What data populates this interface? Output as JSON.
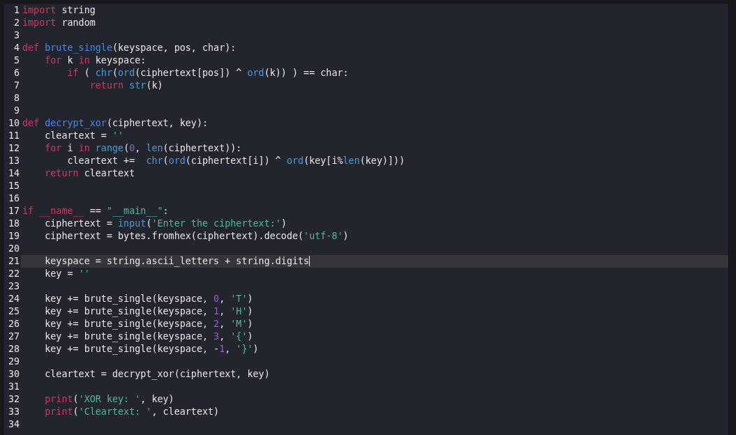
{
  "editor": {
    "lines": [
      {
        "number": "1",
        "current": false,
        "tokens": [
          {
            "kind": "keyword",
            "text": "import"
          },
          {
            "kind": "plain",
            "text": " string"
          }
        ]
      },
      {
        "number": "2",
        "current": false,
        "tokens": [
          {
            "kind": "keyword",
            "text": "import"
          },
          {
            "kind": "plain",
            "text": " random"
          }
        ]
      },
      {
        "number": "3",
        "current": false
      },
      {
        "number": "4",
        "current": false,
        "tokens": [
          {
            "kind": "keyword",
            "text": "def "
          },
          {
            "kind": "function",
            "text": "brute_single"
          },
          {
            "kind": "plain",
            "text": "(keyspace, pos, char):"
          }
        ]
      },
      {
        "number": "5",
        "current": false,
        "tokens": [
          {
            "kind": "keyword",
            "text": "    for"
          },
          {
            "kind": "plain",
            "text": " k "
          },
          {
            "kind": "keyword",
            "text": "in"
          },
          {
            "kind": "plain",
            "text": " keyspace:"
          }
        ]
      },
      {
        "number": "6",
        "current": false,
        "tokens": [
          {
            "kind": "keyword",
            "text": "        if"
          },
          {
            "kind": "plain",
            "text": " ( "
          },
          {
            "kind": "builtin",
            "text": "chr"
          },
          {
            "kind": "plain",
            "text": "("
          },
          {
            "kind": "builtin",
            "text": "ord"
          },
          {
            "kind": "plain",
            "text": "(ciphertext[pos]) ^ "
          },
          {
            "kind": "builtin",
            "text": "ord"
          },
          {
            "kind": "plain",
            "text": "(k)) ) == char:"
          }
        ]
      },
      {
        "number": "7",
        "current": false,
        "tokens": [
          {
            "kind": "keyword",
            "text": "            return "
          },
          {
            "kind": "builtin",
            "text": "str"
          },
          {
            "kind": "plain",
            "text": "(k)"
          }
        ]
      },
      {
        "number": "8",
        "current": false
      },
      {
        "number": "9",
        "current": false
      },
      {
        "number": "10",
        "current": false,
        "tokens": [
          {
            "kind": "keyword",
            "text": "def "
          },
          {
            "kind": "function",
            "text": "decrypt_xor"
          },
          {
            "kind": "plain",
            "text": "(ciphertext, key):"
          }
        ]
      },
      {
        "number": "11",
        "current": false,
        "tokens": [
          {
            "kind": "plain",
            "text": "    cleartext = "
          },
          {
            "kind": "string",
            "text": "''"
          }
        ]
      },
      {
        "number": "12",
        "current": false,
        "tokens": [
          {
            "kind": "keyword",
            "text": "    for"
          },
          {
            "kind": "plain",
            "text": " i "
          },
          {
            "kind": "keyword",
            "text": "in "
          },
          {
            "kind": "builtin",
            "text": "range"
          },
          {
            "kind": "plain",
            "text": "("
          },
          {
            "kind": "number",
            "text": "0"
          },
          {
            "kind": "plain",
            "text": ", "
          },
          {
            "kind": "builtin",
            "text": "len"
          },
          {
            "kind": "plain",
            "text": "(ciphertext)):"
          }
        ]
      },
      {
        "number": "13",
        "current": false,
        "tokens": [
          {
            "kind": "plain",
            "text": "        cleartext +=  "
          },
          {
            "kind": "builtin",
            "text": "chr"
          },
          {
            "kind": "plain",
            "text": "("
          },
          {
            "kind": "builtin",
            "text": "ord"
          },
          {
            "kind": "plain",
            "text": "(ciphertext[i]) ^ "
          },
          {
            "kind": "builtin",
            "text": "ord"
          },
          {
            "kind": "plain",
            "text": "(key[i%"
          },
          {
            "kind": "builtin",
            "text": "len"
          },
          {
            "kind": "plain",
            "text": "(key)]))"
          }
        ]
      },
      {
        "number": "14",
        "current": false,
        "tokens": [
          {
            "kind": "keyword",
            "text": "    return"
          },
          {
            "kind": "plain",
            "text": " cleartext"
          }
        ]
      },
      {
        "number": "15",
        "current": false
      },
      {
        "number": "16",
        "current": false
      },
      {
        "number": "17",
        "current": false,
        "tokens": [
          {
            "kind": "keyword",
            "text": "if __name__"
          },
          {
            "kind": "plain",
            "text": " == "
          },
          {
            "kind": "string",
            "text": "\"__main__\""
          },
          {
            "kind": "plain",
            "text": ":"
          }
        ]
      },
      {
        "number": "18",
        "current": false,
        "tokens": [
          {
            "kind": "plain",
            "text": "    ciphertext = "
          },
          {
            "kind": "builtin",
            "text": "input"
          },
          {
            "kind": "plain",
            "text": "("
          },
          {
            "kind": "string",
            "text": "'Enter the ciphertext:'"
          },
          {
            "kind": "plain",
            "text": ")"
          }
        ]
      },
      {
        "number": "19",
        "current": false,
        "tokens": [
          {
            "kind": "plain",
            "text": "    ciphertext = bytes.fromhex(ciphertext).decode("
          },
          {
            "kind": "string",
            "text": "'utf-8'"
          },
          {
            "kind": "plain",
            "text": ")"
          }
        ]
      },
      {
        "number": "20",
        "current": false
      },
      {
        "number": "21",
        "current": true,
        "tokens": [
          {
            "kind": "plain",
            "text": "    keyspace = string.ascii_letters + string.digits"
          }
        ]
      },
      {
        "number": "22",
        "current": false,
        "tokens": [
          {
            "kind": "plain",
            "text": "    key = "
          },
          {
            "kind": "string",
            "text": "''"
          }
        ]
      },
      {
        "number": "23",
        "current": false
      },
      {
        "number": "24",
        "current": false,
        "tokens": [
          {
            "kind": "plain",
            "text": "    key += brute_single(keyspace, "
          },
          {
            "kind": "number",
            "text": "0"
          },
          {
            "kind": "plain",
            "text": ", "
          },
          {
            "kind": "string",
            "text": "'T'"
          },
          {
            "kind": "plain",
            "text": ")"
          }
        ]
      },
      {
        "number": "25",
        "current": false,
        "tokens": [
          {
            "kind": "plain",
            "text": "    key += brute_single(keyspace, "
          },
          {
            "kind": "number",
            "text": "1"
          },
          {
            "kind": "plain",
            "text": ", "
          },
          {
            "kind": "string",
            "text": "'H'"
          },
          {
            "kind": "plain",
            "text": ")"
          }
        ]
      },
      {
        "number": "26",
        "current": false,
        "tokens": [
          {
            "kind": "plain",
            "text": "    key += brute_single(keyspace, "
          },
          {
            "kind": "number",
            "text": "2"
          },
          {
            "kind": "plain",
            "text": ", "
          },
          {
            "kind": "string",
            "text": "'M'"
          },
          {
            "kind": "plain",
            "text": ")"
          }
        ]
      },
      {
        "number": "27",
        "current": false,
        "tokens": [
          {
            "kind": "plain",
            "text": "    key += brute_single(keyspace, "
          },
          {
            "kind": "number",
            "text": "3"
          },
          {
            "kind": "plain",
            "text": ", "
          },
          {
            "kind": "string",
            "text": "'{'"
          },
          {
            "kind": "plain",
            "text": ")"
          }
        ]
      },
      {
        "number": "28",
        "current": false,
        "tokens": [
          {
            "kind": "plain",
            "text": "    key += brute_single(keyspace, -"
          },
          {
            "kind": "number",
            "text": "1"
          },
          {
            "kind": "plain",
            "text": ", "
          },
          {
            "kind": "string",
            "text": "'}'"
          },
          {
            "kind": "plain",
            "text": ")"
          }
        ]
      },
      {
        "number": "29",
        "current": false
      },
      {
        "number": "30",
        "current": false,
        "tokens": [
          {
            "kind": "plain",
            "text": "    cleartext = decrypt_xor(ciphertext, key)"
          }
        ]
      },
      {
        "number": "31",
        "current": false
      },
      {
        "number": "32",
        "current": false,
        "tokens": [
          {
            "kind": "keyword",
            "text": "    print"
          },
          {
            "kind": "plain",
            "text": "("
          },
          {
            "kind": "string",
            "text": "'XOR key: '"
          },
          {
            "kind": "plain",
            "text": ", key)"
          }
        ]
      },
      {
        "number": "33",
        "current": false,
        "tokens": [
          {
            "kind": "keyword",
            "text": "    print"
          },
          {
            "kind": "plain",
            "text": "("
          },
          {
            "kind": "string",
            "text": "'Cleartext: '"
          },
          {
            "kind": "plain",
            "text": ", cleartext)"
          }
        ]
      },
      {
        "number": "34",
        "current": false
      }
    ]
  }
}
